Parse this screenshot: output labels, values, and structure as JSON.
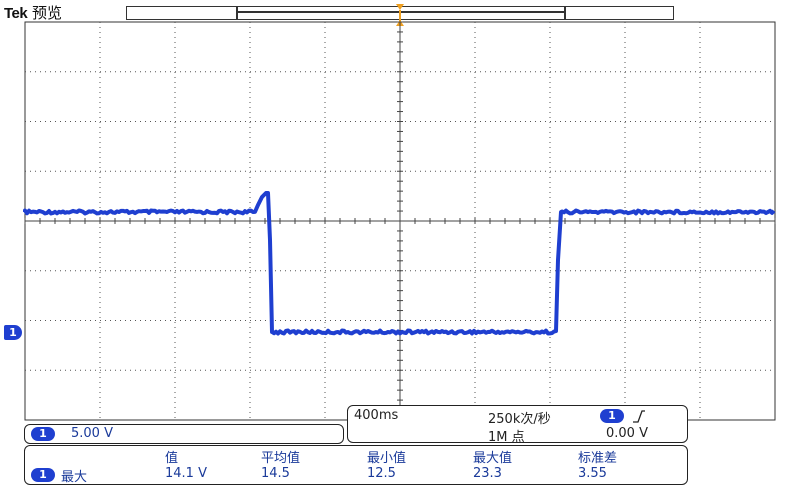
{
  "header": {
    "brand": "Tek",
    "mode": "预览"
  },
  "channel": {
    "number": "1",
    "scale": "5.00 V"
  },
  "timebase": {
    "time_per_div": "400ms",
    "sample_rate": "250k次/秒",
    "record_length": "1M 点",
    "trigger_level": "0.00 V"
  },
  "measurements": {
    "headers": [
      "值",
      "平均值",
      "最小值",
      "最大值",
      "标准差"
    ],
    "rows": [
      {
        "label": "最大",
        "values": [
          "14.1 V",
          "14.5",
          "12.5",
          "23.3",
          "3.55"
        ]
      }
    ]
  },
  "colors": {
    "trace": "#1f3fd0",
    "grid": "#555555"
  }
}
